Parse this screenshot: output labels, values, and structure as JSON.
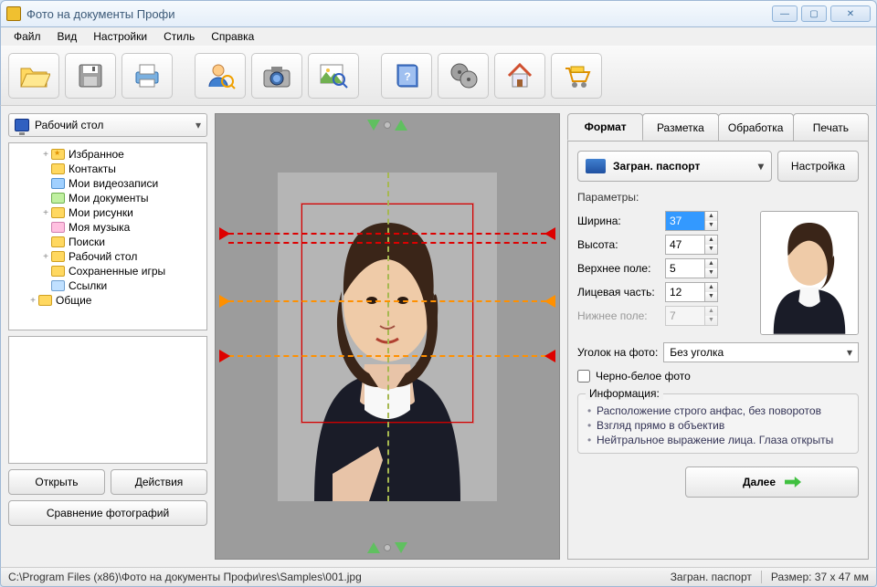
{
  "title": "Фото на документы Профи",
  "menu": [
    "Файл",
    "Вид",
    "Настройки",
    "Стиль",
    "Справка"
  ],
  "toolbar_icons": [
    "open-folder-icon",
    "save-icon",
    "print-icon",
    "user-edit-icon",
    "camera-icon",
    "zoom-image-icon",
    "help-book-icon",
    "movie-reel-icon",
    "home-icon",
    "cart-icon"
  ],
  "drive": {
    "label": "Рабочий стол"
  },
  "tree": [
    {
      "exp": "+",
      "icon": "fav",
      "label": "Избранное"
    },
    {
      "exp": "",
      "icon": "usr",
      "label": "Контакты"
    },
    {
      "exp": "",
      "icon": "vid",
      "label": "Мои видеозаписи"
    },
    {
      "exp": "",
      "icon": "doc",
      "label": "Мои документы"
    },
    {
      "exp": "+",
      "icon": "img",
      "label": "Мои рисунки"
    },
    {
      "exp": "",
      "icon": "mus",
      "label": "Моя музыка"
    },
    {
      "exp": "",
      "icon": "srch",
      "label": "Поиски"
    },
    {
      "exp": "+",
      "icon": "img",
      "label": "Рабочий стол"
    },
    {
      "exp": "",
      "icon": "img",
      "label": "Сохраненные игры"
    },
    {
      "exp": "",
      "icon": "lnk",
      "label": "Ссылки"
    },
    {
      "exp": "+",
      "icon": "img",
      "label": "Общие"
    }
  ],
  "left_buttons": {
    "open": "Открыть",
    "actions": "Действия",
    "compare": "Сравнение фотографий"
  },
  "tabs": [
    "Формат",
    "Разметка",
    "Обработка",
    "Печать"
  ],
  "format": {
    "preset": "Загран. паспорт",
    "settings_btn": "Настройка",
    "params_label": "Параметры:",
    "width_label": "Ширина:",
    "width_value": "37",
    "height_label": "Высота:",
    "height_value": "47",
    "top_label": "Верхнее поле:",
    "top_value": "5",
    "face_label": "Лицевая часть:",
    "face_value": "12",
    "bottom_label": "Нижнее поле:",
    "bottom_value": "7",
    "corner_label": "Уголок на фото:",
    "corner_value": "Без уголка",
    "bw_label": "Черно-белое фото"
  },
  "info": {
    "title": "Информация:",
    "items": [
      "Расположение строго анфас, без поворотов",
      "Взгляд прямо в объектив",
      "Нейтральное выражение лица. Глаза открыты"
    ]
  },
  "next_label": "Далее",
  "status": {
    "path": "C:\\Program Files (x86)\\Фото на документы Профи\\res\\Samples\\001.jpg",
    "preset": "Загран. паспорт",
    "size_label": "Размер: 37 x 47 мм"
  }
}
